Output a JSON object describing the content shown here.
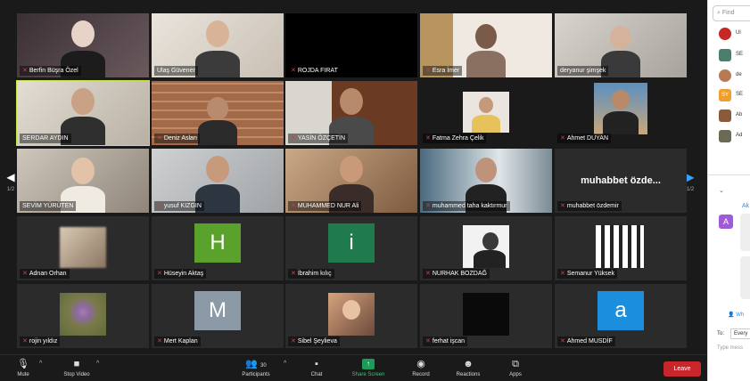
{
  "toolbar": {
    "mute": "Mute",
    "stop_video": "Stop Video",
    "participants": "Participants",
    "participants_count": "30",
    "chat": "Chat",
    "share_screen": "Share Screen",
    "record": "Record",
    "reactions": "Reactions",
    "apps": "Apps",
    "leave": "Leave"
  },
  "pager": {
    "left_page": "1/2",
    "right_page": "1/2"
  },
  "tiles": [
    {
      "name": "Berfin Büşra Özel",
      "muted": true
    },
    {
      "name": "Ulaş Güvener",
      "muted": false
    },
    {
      "name": "ROJDA FIRAT",
      "muted": true
    },
    {
      "name": "Esra İmer",
      "muted": true
    },
    {
      "name": "deryanur şimşek",
      "muted": false
    },
    {
      "name": "SERDAR AYDIN",
      "muted": false
    },
    {
      "name": "Deniz Aslan",
      "muted": true
    },
    {
      "name": "YASİN ÖZÇETİN",
      "muted": true
    },
    {
      "name": "Fatma Zehra Çelik",
      "muted": true
    },
    {
      "name": "Ahmet DUYAN",
      "muted": true
    },
    {
      "name": "SEVİM YÜRÜTEN",
      "muted": false
    },
    {
      "name": "yusuf KIZGIN",
      "muted": true
    },
    {
      "name": "MUHAMMED NUR Ali",
      "muted": true
    },
    {
      "name": "muhammed taha kaktırmur",
      "muted": true
    },
    {
      "name": "muhabbet özdemir",
      "muted": true,
      "big_label": "muhabbet özde..."
    },
    {
      "name": "Adnan Orhan",
      "muted": true
    },
    {
      "name": "Hüseyin Aktaş",
      "muted": true,
      "letter": "H",
      "color": "#5ba22c"
    },
    {
      "name": "İbrahim kılıç",
      "muted": true,
      "letter": "i",
      "color": "#1f7a4c"
    },
    {
      "name": "NURHAK BOZDAĞ",
      "muted": true
    },
    {
      "name": "Semanur Yüksek",
      "muted": true
    },
    {
      "name": "rojin yıldız",
      "muted": true
    },
    {
      "name": "Mert Kaplan",
      "muted": true,
      "letter": "M",
      "color": "#8b9aa6"
    },
    {
      "name": "Sibel Şeylieva",
      "muted": true
    },
    {
      "name": "ferhat işcan",
      "muted": true
    },
    {
      "name": "Ahmed MUSDİF",
      "muted": true,
      "letter": "a",
      "color": "#1b8fdd"
    }
  ],
  "sidebar": {
    "find_placeholder": "Find",
    "participants": [
      {
        "initials": "",
        "label": "Ul",
        "color": "#c62828"
      },
      {
        "initials": "",
        "label": "SE",
        "color": "#4a7f6e"
      },
      {
        "initials": "",
        "label": "de",
        "color": "#b97955"
      },
      {
        "initials": "SY",
        "label": "SE",
        "color": "#f0a02a"
      },
      {
        "initials": "",
        "label": "Ab",
        "color": "#8a5a3a"
      },
      {
        "initials": "",
        "label": "Ad",
        "color": "#6b6b55"
      }
    ],
    "chat_title": "Ak",
    "msg_avatar": "A",
    "who_can_see": "Wh",
    "to_label": "To:",
    "to_value": "Every",
    "type_message": "Type mess"
  },
  "colors": {
    "speaking_outline": "#c8e64b",
    "leave_button": "#c9262c",
    "share_screen": "#1e9b5a",
    "muted_icon": "#e0393e",
    "accent": "#2d8cff"
  }
}
